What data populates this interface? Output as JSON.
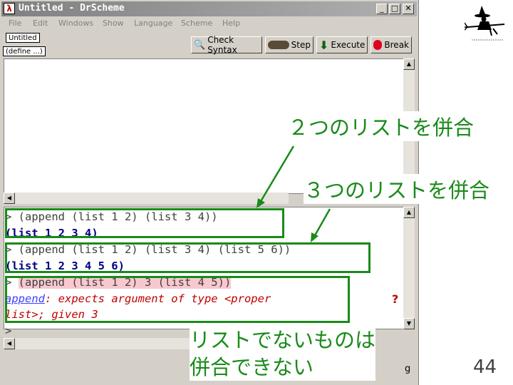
{
  "window": {
    "title": "Untitled - DrScheme",
    "app_icon": "λ",
    "controls": [
      "_",
      "□",
      "✕"
    ]
  },
  "menu": [
    "File",
    "Edit",
    "Windows",
    "Show",
    "Language",
    "Scheme",
    "Help"
  ],
  "toolbar": {
    "file_tab": "Untitled",
    "define_popup": "(define ...)",
    "check_syntax": "Check Syntax",
    "step": "Step",
    "execute": "Execute",
    "break": "Break"
  },
  "repl": {
    "line1": "> (append (list 1 2) (list 3 4))",
    "line2": "(list 1 2 3 4)",
    "line3": "> (append (list 1 2) (list 3 4) (list 5 6))",
    "line4": "(list 1 2 3 4 5 6)",
    "line5_prompt": "> ",
    "line5_expr": "(append (list 1 2) 3 (list 4 5))",
    "line6_word": "append",
    "line6_rest": ": expects argument of type <proper",
    "line7": "list>; given 3",
    "line8": ">"
  },
  "annotations": {
    "two_lists": "２つのリストを併合",
    "three_lists": "３つのリストを併合",
    "non_list_1": "リストでないものは",
    "non_list_2": "併合できない"
  },
  "status_fragment": "g",
  "page_number": "44",
  "colors": {
    "annotation_green": "#1a8a1a",
    "error_red": "#c00000",
    "result_blue": "#000080",
    "error_highlight": "#f8c8d0"
  }
}
